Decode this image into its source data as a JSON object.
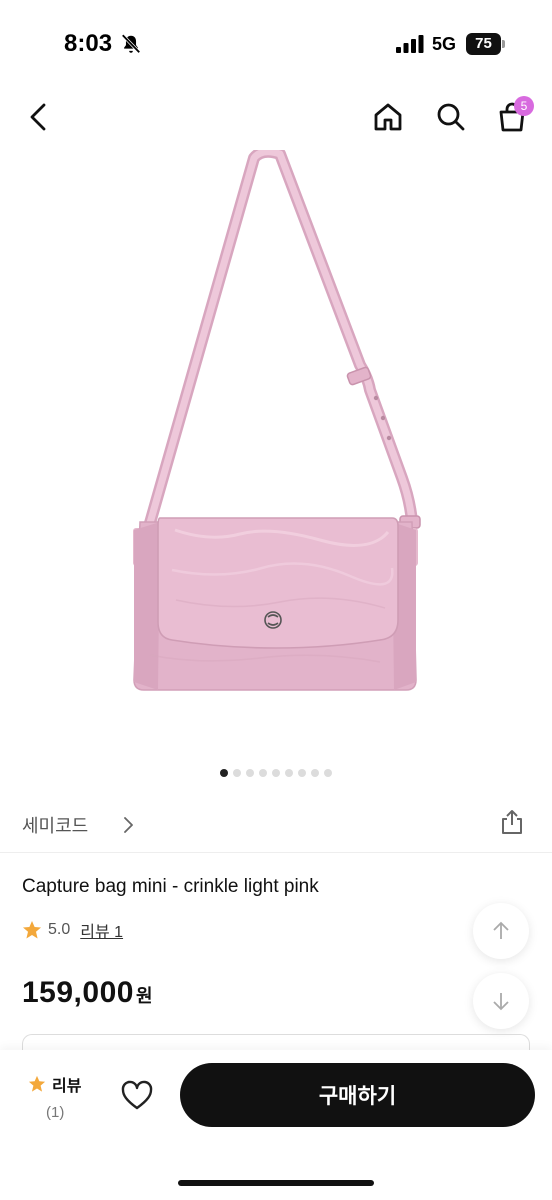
{
  "status_bar": {
    "time": "8:03",
    "network": "5G",
    "battery": "75"
  },
  "nav": {
    "cart_count": "5"
  },
  "gallery": {
    "image_count": 9,
    "active_index": 0
  },
  "product": {
    "brand": "세미코드",
    "name": "Capture bag mini - crinkle light pink",
    "rating": "5.0",
    "review_link": "리뷰 1",
    "price": "159,000",
    "currency": "원",
    "color": "#e6b8cf"
  },
  "bottom_bar": {
    "review_label": "리뷰",
    "review_count": "(1)",
    "buy_label": "구매하기"
  },
  "colors": {
    "accent_badge": "#d86adf",
    "star": "#f3a83b",
    "button": "#111111"
  }
}
